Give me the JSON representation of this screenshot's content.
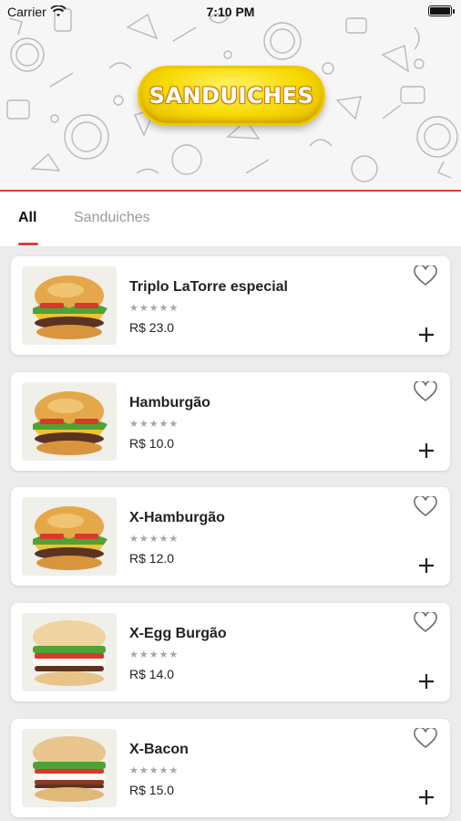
{
  "status_bar": {
    "carrier": "Carrier",
    "time": "7:10 PM"
  },
  "header": {
    "logo_text": "SANDUICHES",
    "accent_color": "#e23a3a",
    "logo_color": "#f6d900"
  },
  "tabs": [
    {
      "label": "All",
      "active": true
    },
    {
      "label": "Sanduiches",
      "active": false
    }
  ],
  "products": [
    {
      "name": "Triplo LaTorre especial",
      "rating": "★★★★★",
      "price": "R$ 23.0",
      "fav_icon": "heart-outline-icon",
      "add_icon": "plus-icon"
    },
    {
      "name": "Hamburgão",
      "rating": "★★★★★",
      "price": "R$ 10.0",
      "fav_icon": "heart-outline-icon",
      "add_icon": "plus-icon"
    },
    {
      "name": "X-Hamburgão",
      "rating": "★★★★★",
      "price": "R$ 12.0",
      "fav_icon": "heart-outline-icon",
      "add_icon": "plus-icon"
    },
    {
      "name": "X-Egg Burgão",
      "rating": "★★★★★",
      "price": "R$ 14.0",
      "fav_icon": "heart-outline-icon",
      "add_icon": "plus-icon"
    },
    {
      "name": "X-Bacon",
      "rating": "★★★★★",
      "price": "R$ 15.0",
      "fav_icon": "heart-outline-icon",
      "add_icon": "plus-icon"
    }
  ]
}
